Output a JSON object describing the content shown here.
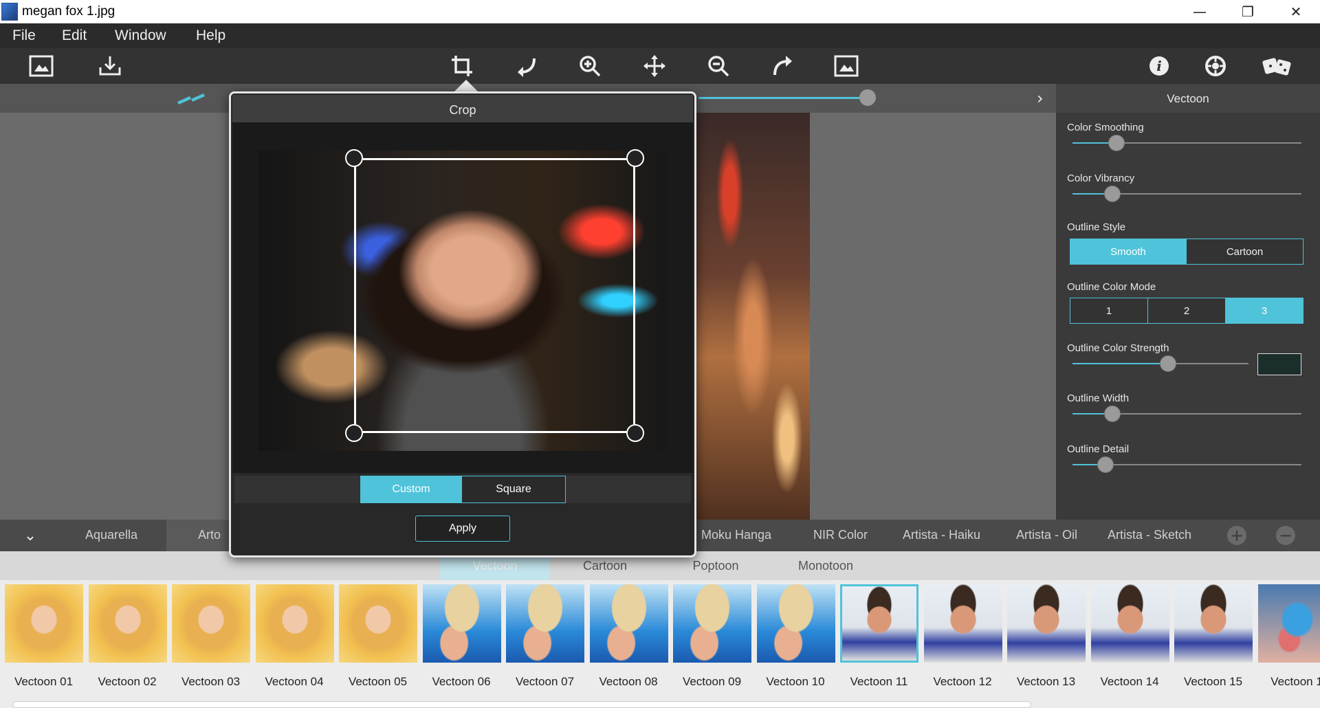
{
  "window": {
    "title": "megan fox 1.jpg",
    "minimize": "—",
    "restore": "❐",
    "close": "✕"
  },
  "menu": [
    "File",
    "Edit",
    "Window",
    "Help"
  ],
  "toolbar": {
    "left": [
      "open-image-icon",
      "save-icon"
    ],
    "center": [
      "crop-icon",
      "rotate-left-icon",
      "zoom-in-icon",
      "pan-icon",
      "zoom-out-icon",
      "rotate-right-icon",
      "fit-screen-icon"
    ],
    "right": [
      "info-icon",
      "settings-icon",
      "randomize-icon"
    ]
  },
  "right_panel": {
    "title": "Vectoon",
    "color_smoothing": {
      "label": "Color Smoothing",
      "value": 0.19
    },
    "color_vibrancy": {
      "label": "Color Vibrancy",
      "value": 0.17
    },
    "outline_style": {
      "label": "Outline Style",
      "options": [
        "Smooth",
        "Cartoon"
      ],
      "selected": "Smooth"
    },
    "outline_color_mode": {
      "label": "Outline Color Mode",
      "options": [
        "1",
        "2",
        "3"
      ],
      "selected": "3"
    },
    "outline_color_strength": {
      "label": "Outline Color Strength",
      "value": 0.54,
      "swatch": "#1c2e2c"
    },
    "outline_width": {
      "label": "Outline Width",
      "value": 0.17
    },
    "outline_detail": {
      "label": "Outline Detail",
      "value": 0.14
    }
  },
  "categories": {
    "collapse_icon": "chevron-down-icon",
    "tabs": [
      "Aquarella",
      "Arto",
      "Moku Hanga",
      "NIR Color",
      "Artista - Haiku",
      "Artista - Oil",
      "Artista - Sketch"
    ],
    "add_icon": "plus-icon",
    "remove_icon": "minus-icon"
  },
  "subtabs": [
    "Vectoon",
    "Cartoon",
    "Poptoon",
    "Monotoon"
  ],
  "presets": [
    {
      "label": "Vectoon 01",
      "kind": "blonde"
    },
    {
      "label": "Vectoon 02",
      "kind": "blonde"
    },
    {
      "label": "Vectoon 03",
      "kind": "blonde"
    },
    {
      "label": "Vectoon 04",
      "kind": "blonde"
    },
    {
      "label": "Vectoon 05",
      "kind": "blonde"
    },
    {
      "label": "Vectoon 06",
      "kind": "hat"
    },
    {
      "label": "Vectoon 07",
      "kind": "hat"
    },
    {
      "label": "Vectoon 08",
      "kind": "hat"
    },
    {
      "label": "Vectoon 09",
      "kind": "hat"
    },
    {
      "label": "Vectoon 10",
      "kind": "hat"
    },
    {
      "label": "Vectoon 11",
      "kind": "guy",
      "selected": true
    },
    {
      "label": "Vectoon 12",
      "kind": "guy"
    },
    {
      "label": "Vectoon 13",
      "kind": "guy"
    },
    {
      "label": "Vectoon 14",
      "kind": "guy"
    },
    {
      "label": "Vectoon 15",
      "kind": "guy"
    },
    {
      "label": "Vectoon 1",
      "kind": "goggle"
    }
  ],
  "crop": {
    "title": "Crop",
    "modes": [
      "Custom",
      "Square"
    ],
    "selected_mode": "Custom",
    "apply": "Apply"
  },
  "accent_color": "#4fc3d9"
}
